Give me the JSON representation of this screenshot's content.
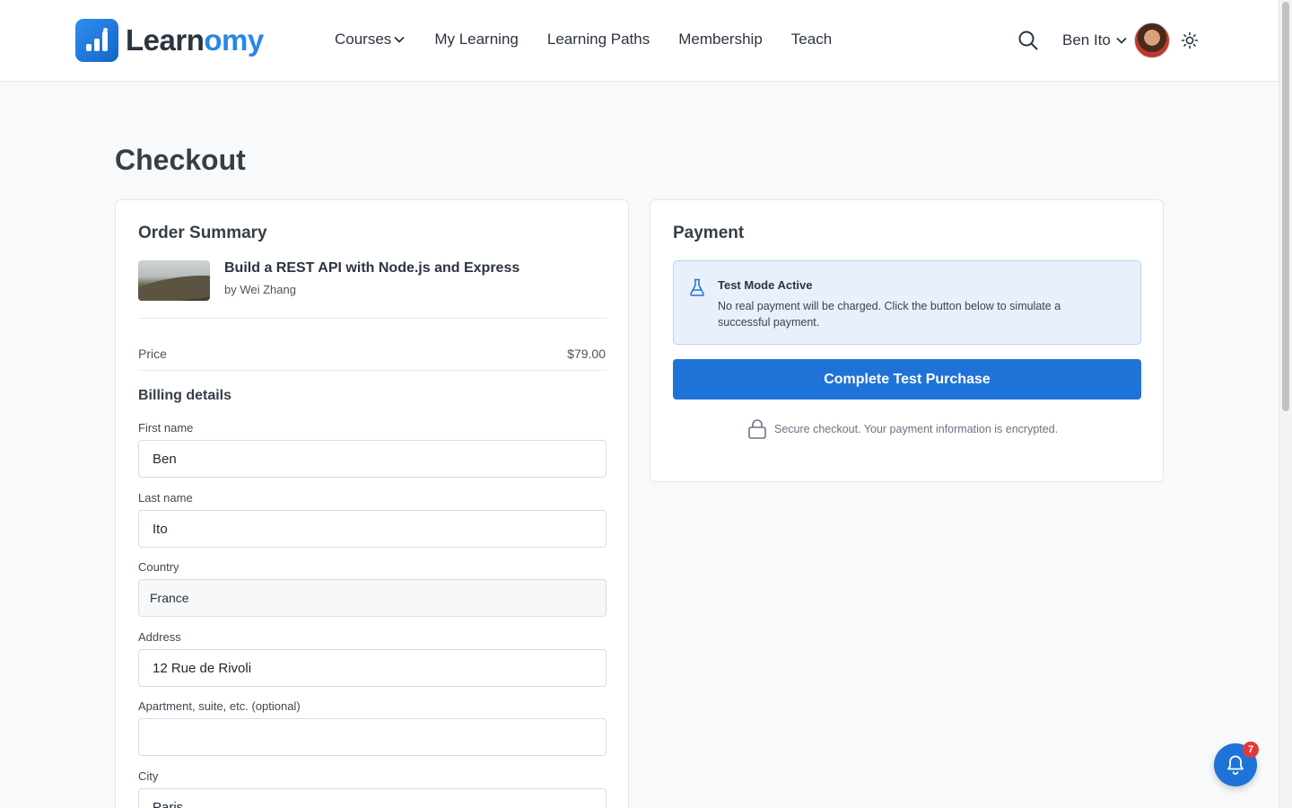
{
  "header": {
    "logo": {
      "part1": "Learn",
      "part2": "omy"
    },
    "nav": [
      {
        "label": "Courses",
        "has_dropdown": true
      },
      {
        "label": "My Learning"
      },
      {
        "label": "Learning Paths"
      },
      {
        "label": "Membership"
      },
      {
        "label": "Teach"
      }
    ],
    "user_name": "Ben Ito",
    "icons": [
      "search-icon",
      "chevron-down-icon",
      "avatar",
      "sun-icon"
    ]
  },
  "page": {
    "title": "Checkout"
  },
  "order_summary": {
    "title": "Order Summary",
    "course_title": "Build a REST API with Node.js and Express",
    "course_author": "by Wei Zhang",
    "price_label": "Price",
    "price_value": "$79.00"
  },
  "billing": {
    "title": "Billing details",
    "first_name": {
      "label": "First name",
      "value": "Ben"
    },
    "last_name": {
      "label": "Last name",
      "value": "Ito"
    },
    "country": {
      "label": "Country",
      "value": "France"
    },
    "address": {
      "label": "Address",
      "value": "12 Rue de Rivoli"
    },
    "apartment": {
      "label": "Apartment, suite, etc. (optional)",
      "value": ""
    },
    "city": {
      "label": "City",
      "value": "Paris"
    }
  },
  "payment": {
    "title": "Payment",
    "test_title": "Test Mode Active",
    "test_text": "No real payment will be charged. Click the button below to simulate a successful payment.",
    "button_label": "Complete Test Purchase",
    "secure_text": "Secure checkout. Your payment information is encrypted."
  },
  "notifications": {
    "count": "7"
  },
  "colors": {
    "primary": "#1f72d8",
    "brand_accent": "#2a86e6",
    "badge": "#e0383b"
  }
}
